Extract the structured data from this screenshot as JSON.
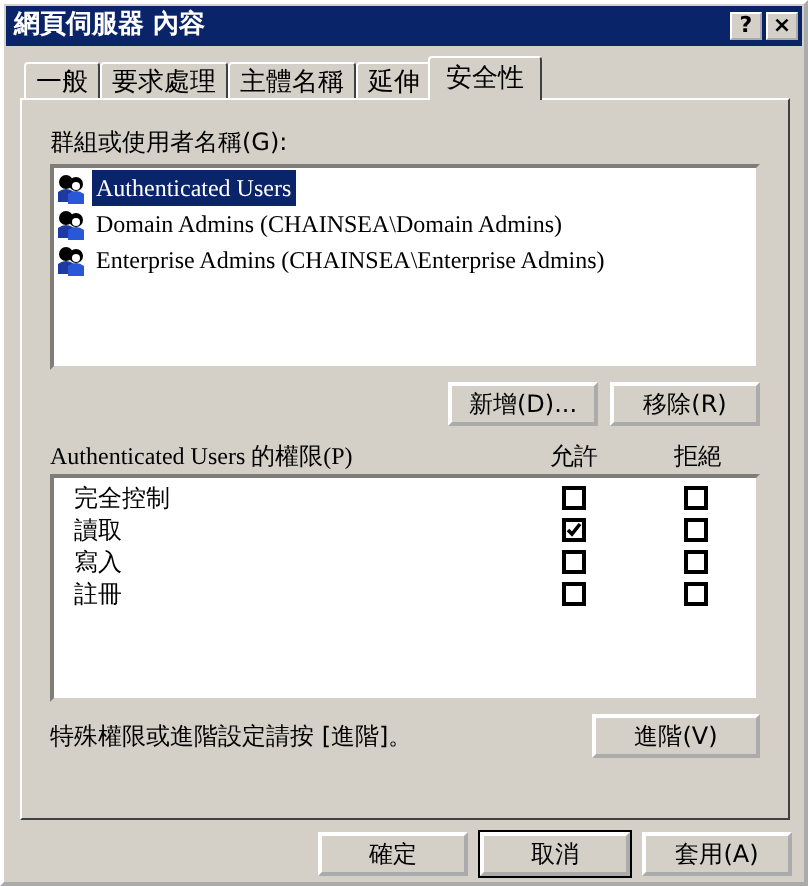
{
  "window": {
    "title": "網頁伺服器 內容",
    "buttons": [
      "?",
      "×"
    ]
  },
  "tabs": [
    {
      "label": "一般",
      "selected": false
    },
    {
      "label": "要求處理",
      "selected": false
    },
    {
      "label": "主體名稱",
      "selected": false
    },
    {
      "label": "延伸",
      "selected": false
    },
    {
      "label": "安全性",
      "selected": true
    }
  ],
  "groups_label": "群組或使用者名稱(G):",
  "groups": [
    {
      "name": "Authenticated Users",
      "selected": true
    },
    {
      "name": "Domain Admins (CHAINSEA\\Domain Admins)",
      "selected": false
    },
    {
      "name": "Enterprise Admins (CHAINSEA\\Enterprise Admins)",
      "selected": false
    }
  ],
  "group_buttons": [
    "新增(D)...",
    "移除(R)"
  ],
  "permissions_label": "Authenticated Users 的權限(P)",
  "permission_columns": [
    "允許",
    "拒絕"
  ],
  "permissions": [
    {
      "name": "完全控制",
      "allow": false,
      "deny": false
    },
    {
      "name": "讀取",
      "allow": true,
      "deny": false
    },
    {
      "name": "寫入",
      "allow": false,
      "deny": false
    },
    {
      "name": "註冊",
      "allow": false,
      "deny": false
    }
  ],
  "advanced_text": "特殊權限或進階設定請按 [進階]。",
  "advanced_button": "進階(V)",
  "dialog_buttons": [
    {
      "label": "確定",
      "default": false
    },
    {
      "label": "取消",
      "default": true
    },
    {
      "label": "套用(A)",
      "default": false
    }
  ]
}
